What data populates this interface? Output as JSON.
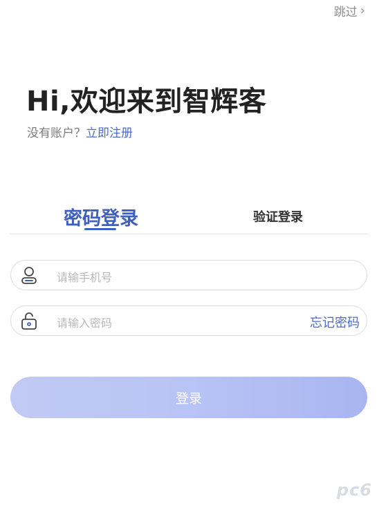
{
  "header": {
    "skip_label": "跳过"
  },
  "welcome": {
    "title": "Hi,欢迎来到智辉客",
    "no_account_text": "没有账户？",
    "register_link": "立即注册"
  },
  "tabs": {
    "password_login": "密码登录",
    "code_login": "验证登录"
  },
  "form": {
    "phone_placeholder": "请输手机号",
    "password_placeholder": "请输入密码",
    "forgot_password": "忘记密码"
  },
  "actions": {
    "login_label": "登录"
  },
  "watermark": "pc6",
  "colors": {
    "accent": "#3f5fbf",
    "link": "#4b6bc8",
    "button_gradient_start": "#c1caf4",
    "button_gradient_end": "#a9b5f0"
  }
}
